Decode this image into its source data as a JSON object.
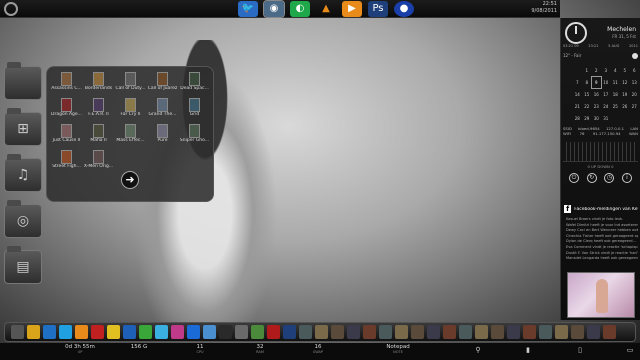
{
  "topbar": {
    "date_time": "22:51",
    "date": "9/08/2011"
  },
  "top_icons": [
    "bird-icon",
    "photo-app-icon",
    "green-app-icon",
    "vlc-icon",
    "media-player-icon",
    "photoshop-icon",
    "globe-icon"
  ],
  "colors": {
    "accent": "#2a6cc4",
    "photoshop": "#1e3f7a",
    "vlc": "#e88b1a",
    "green": "#1fa84a"
  },
  "games": [
    {
      "label": "Assassins C..."
    },
    {
      "label": "Borderlands"
    },
    {
      "label": "Call of Duty..."
    },
    {
      "label": "Call of Juarez"
    },
    {
      "label": "Dead Spac..."
    },
    {
      "label": "Dragon Age..."
    },
    {
      "label": "F.E.A.R. II"
    },
    {
      "label": "Far Cry II"
    },
    {
      "label": "Grand The..."
    },
    {
      "label": "Grid"
    },
    {
      "label": "Just Cause II"
    },
    {
      "label": "Mafia II"
    },
    {
      "label": "Mass Effec..."
    },
    {
      "label": "Pure"
    },
    {
      "label": "Sniper Gho..."
    },
    {
      "label": "Street Figh..."
    },
    {
      "label": "X-Men Orig..."
    }
  ],
  "folders": [
    "folder-icon",
    "gamepad-icon",
    "music-icon",
    "camera-icon",
    "film-icon"
  ],
  "sidebar": {
    "city": "Mechelen",
    "city_sub": "FR 31, 5 Fst",
    "sun_times": [
      "03:21 09",
      "23:21",
      "5 AUG",
      "2011"
    ],
    "weather_temp": "12°",
    "weather_desc": "Fair",
    "calendar": [
      "",
      "1",
      "2",
      "3",
      "4",
      "5",
      "6",
      "7",
      "8",
      "9",
      "10",
      "11",
      "12",
      "13",
      "14",
      "15",
      "16",
      "17",
      "18",
      "19",
      "20",
      "21",
      "22",
      "23",
      "24",
      "25",
      "26",
      "27",
      "28",
      "29",
      "30",
      "31"
    ],
    "today": "9",
    "net_rows": [
      [
        "SSID",
        "bloed-9654",
        "127.0.0.1",
        "LAN"
      ],
      [
        "WIFI",
        "76",
        "91.177.150.94",
        "WAN"
      ]
    ],
    "up_label": "0    UP    DOWN    0",
    "sys_icons": [
      "power",
      "refresh",
      "clock",
      "info"
    ],
    "fb_title": "Facebook-meldingen van Kevin",
    "fb_items": [
      "Kasuel Broers vindt je foto leuk.",
      "Wafel Dimitri heeft je voor Ind asseteren.",
      "Dewy Coci en Bert Wenneer hebben ook gereageer",
      "Cinechia Tisher heeft ook geroageerd op...",
      "Dylan de Clerq heeft ook gereageerd...",
      "Eva Comment vindt je reactie 'schaplap'...",
      "Dustit F. Van Strick vindt je reactie 'had'...",
      "Mansdet Lengarda heeft ook gereageerd..."
    ]
  },
  "dock_icons": [
    "trash-icon",
    "chrome-icon",
    "firefox-icon",
    "skype-icon",
    "vlc-icon",
    "media-icon",
    "winamp-icon",
    "word-icon",
    "xbox-icon",
    "msn-icon",
    "photo-icon",
    "globe-icon",
    "drop-icon",
    "steam-icon",
    "calculator-icon",
    "garden-icon",
    "ati-icon",
    "ps-icon",
    "game1-icon",
    "game2-icon",
    "game3-icon",
    "game4-icon",
    "game5-icon",
    "game6-icon",
    "game7-icon",
    "game8-icon",
    "game9-icon",
    "game10-icon",
    "game11-icon",
    "game12-icon",
    "game13-icon",
    "game14-icon",
    "game15-icon",
    "game16-icon",
    "game17-icon",
    "game18-icon",
    "game19-icon",
    "game20-icon"
  ],
  "status": {
    "uptime": "0d 3h 55m",
    "uptime_label": "UP",
    "storage": "156 G",
    "storage_label": "",
    "cpu": "11",
    "cpu_label": "CPU",
    "ram": "32",
    "ram_label": "RAM",
    "swap": "16",
    "swap_label": "SWAP",
    "notepad": "Notepad",
    "notepad_label": "NOTE"
  }
}
